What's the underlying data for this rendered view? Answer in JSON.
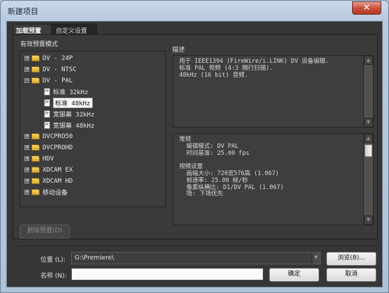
{
  "window": {
    "title": "新建项目",
    "close_glyph": "✕"
  },
  "tabs": [
    {
      "label": "加载预置"
    },
    {
      "label": "自定义设置"
    }
  ],
  "presets": {
    "label": "有效预置模式",
    "tree": [
      {
        "label": "DV - 24P",
        "expander": "+"
      },
      {
        "label": "DV - NTSC",
        "expander": "+"
      },
      {
        "label": "DV - PAL",
        "expander": "−"
      },
      {
        "label": "标准 32kHz",
        "file": "Pr"
      },
      {
        "label": "标准 48kHz",
        "file": "Pr"
      },
      {
        "label": "宽银幕 32kHz",
        "file": "Pr"
      },
      {
        "label": "宽银幕 48kHz",
        "file": "Pr"
      },
      {
        "label": "DVCPRO50",
        "expander": "+"
      },
      {
        "label": "DVCPROHD",
        "expander": "+"
      },
      {
        "label": "HDV",
        "expander": "+"
      },
      {
        "label": "XDCAM EX",
        "expander": "+"
      },
      {
        "label": "XDCAM HD",
        "expander": "+"
      },
      {
        "label": "移动设备",
        "expander": "+"
      }
    ],
    "delete_button": "删除预置(D)"
  },
  "description": {
    "label": "描述",
    "text": "用于 IEEE1394 (FireWire/i.LINK) DV 设备编辑.\n标准 PAL 视频 (4:3 隔行扫描).\n48kHz (16 bit) 音频."
  },
  "info": {
    "text": "常规\n  编辑模式: DV PAL\n  时间基准: 25.00 fps\n\n视频设置\n  画幅大小: 720宽576高 (1.067)\n  帧速率: 25.00 帧/秒\n  像素纵横比: D1/DV PAL (1.067)\n  场: 下场优先"
  },
  "scroll": {
    "up": "▲",
    "down": "▼"
  },
  "location": {
    "label": "位置 (L):",
    "value": "G:\\Premiere\\",
    "browse": "浏览(B)..."
  },
  "name": {
    "label": "名称 (N):",
    "value": ""
  },
  "buttons": {
    "ok": "确定",
    "cancel": "取消"
  }
}
